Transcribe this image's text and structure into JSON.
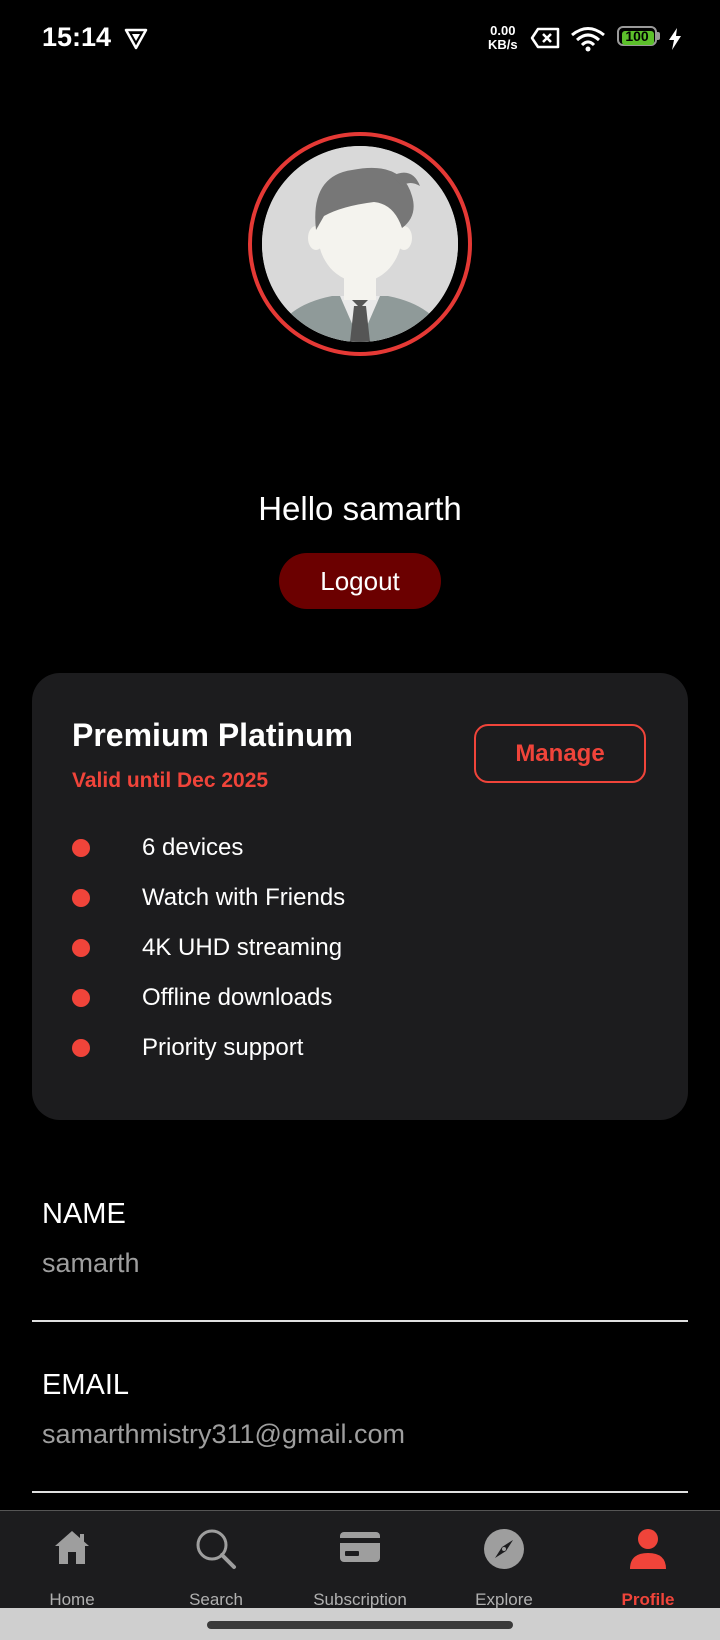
{
  "status_bar": {
    "time": "15:14",
    "net_speed_value": "0.00",
    "net_speed_unit": "KB/s",
    "battery": "100"
  },
  "profile": {
    "greeting": "Hello samarth",
    "logout_label": "Logout"
  },
  "plan": {
    "title": "Premium Platinum",
    "valid_until": "Valid until Dec 2025",
    "manage_label": "Manage",
    "features": [
      "6 devices",
      "Watch with Friends",
      "4K UHD streaming",
      "Offline downloads",
      "Priority support"
    ]
  },
  "fields": {
    "name_label": "NAME",
    "name_value": "samarth",
    "email_label": "EMAIL",
    "email_value": "samarthmistry311@gmail.com"
  },
  "nav": {
    "items": [
      {
        "label": "Home",
        "icon": "home-icon"
      },
      {
        "label": "Search",
        "icon": "search-icon"
      },
      {
        "label": "Subscription",
        "icon": "card-icon"
      },
      {
        "label": "Explore",
        "icon": "compass-icon"
      },
      {
        "label": "Profile",
        "icon": "person-icon"
      }
    ],
    "active": "Profile"
  },
  "colors": {
    "accent": "#f0443a",
    "logout_bg": "#6b0000",
    "card_bg": "#1c1c1e",
    "background": "#000000"
  }
}
